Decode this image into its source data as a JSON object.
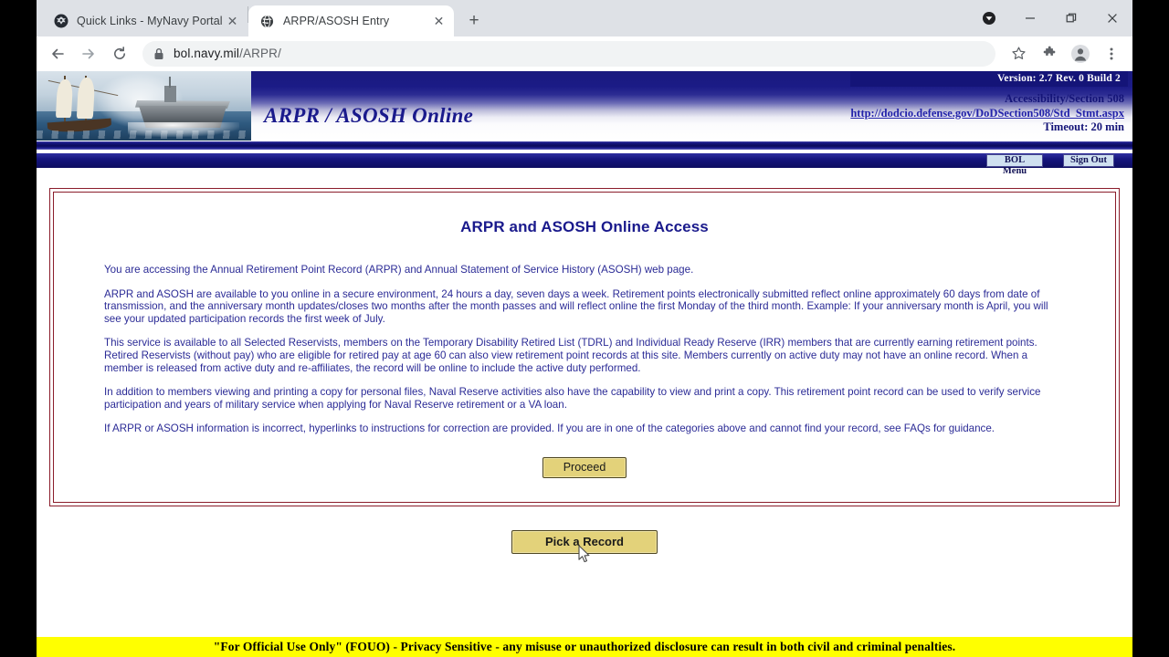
{
  "browser": {
    "tabs": [
      {
        "title": "Quick Links - MyNavy Portal",
        "favicon": "navy-eagle-icon",
        "active": false,
        "close_label": "✕"
      },
      {
        "title": "ARPR/ASOSH Entry",
        "favicon": "globe-icon",
        "active": true,
        "close_label": "✕"
      }
    ],
    "new_tab_label": "+",
    "window_controls": {
      "profile_label": "●",
      "minimize_label": "─",
      "maximize_label": "❐",
      "close_label": "✕"
    },
    "toolbar": {
      "back_label": "←",
      "forward_label": "→",
      "reload_label": "⟳",
      "lock_icon": "lock-icon",
      "url_host": "bol.navy.mil",
      "url_path": "/ARPR/",
      "bookmark_label": "☆",
      "extensions_label": "extensions-puzzle-icon",
      "profile_label": "profile-avatar-icon",
      "menu_label": "⋮"
    }
  },
  "site": {
    "header": {
      "title": "ARPR / ASOSH Online",
      "version": "Version: 2.7 Rev. 0 Build 2",
      "accessibility_label": "Accessibility/Section 508",
      "accessibility_link": "http://dodcio.defense.gov/DoDSection508/Std_Stmt.aspx",
      "timeout": "Timeout: 20 min"
    },
    "nav": {
      "bol_menu": "BOL Menu",
      "sign_out": "Sign Out"
    },
    "main": {
      "title": "ARPR and ASOSH Online Access",
      "paragraphs": [
        "You are accessing the Annual Retirement Point Record (ARPR) and Annual Statement of Service History (ASOSH) web page.",
        "ARPR and ASOSH are available to you online in a secure environment, 24 hours a day, seven days a week. Retirement points electronically submitted reflect online approximately 60 days from date of transmission, and the anniversary month updates/closes two months after the month passes and will reflect online the first Monday of the third month. Example: If your anniversary month is April, you will see your updated participation records the first week of July.",
        "This service is available to all Selected Reservists, members on the Temporary Disability Retired List (TDRL) and Individual Ready Reserve (IRR) members that are currently earning retirement points. Retired Reservists (without pay) who are eligible for retired pay at age 60 can also view retirement point records at this site. Members currently on active duty may not have an online record. When a member is released from active duty and re-affiliates, the record will be online to include the active duty performed.",
        "In addition to members viewing and printing a copy for personal files, Naval Reserve activities also have the capability to view and print a copy. This retirement point record can be used to verify service participation and years of military service when applying for Naval Reserve retirement or a VA loan.",
        "If ARPR or ASOSH information is incorrect, hyperlinks to instructions for correction are provided. If you are in one of the categories above and cannot find your record, see FAQs for guidance."
      ],
      "proceed_button": "Proceed",
      "pick_record_button": "Pick a Record"
    },
    "footer": {
      "fouo": "\"For Official Use Only\" (FOUO) - Privacy Sensitive - any misuse or unauthorized disclosure can result in both civil and criminal penalties."
    }
  },
  "colors": {
    "navy": "#141478",
    "card_border": "#8b1d2b",
    "button_yellow": "#e3d27a",
    "fouo_yellow": "#ffff00",
    "text_blue": "#2b2b96"
  }
}
